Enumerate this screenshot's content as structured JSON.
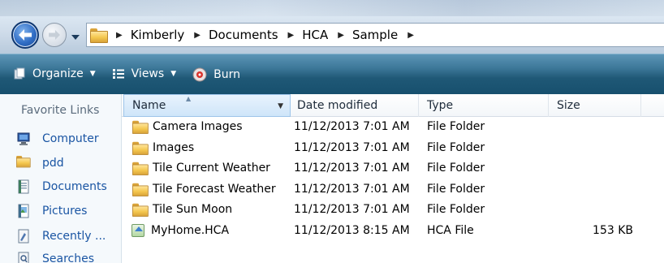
{
  "addressbar": {
    "breadcrumbs": [
      "Kimberly",
      "Documents",
      "HCA",
      "Sample"
    ],
    "back_icon": "back-arrow-icon",
    "forward_icon": "forward-arrow-icon"
  },
  "toolbar": {
    "organize_label": "Organize",
    "views_label": "Views",
    "burn_label": "Burn"
  },
  "favorites": {
    "title": "Favorite Links",
    "items": [
      {
        "label": "Computer",
        "icon": "computer-icon"
      },
      {
        "label": "pdd",
        "icon": "folder-icon"
      },
      {
        "label": "Documents",
        "icon": "documents-icon"
      },
      {
        "label": "Pictures",
        "icon": "pictures-icon"
      },
      {
        "label": "Recently ...",
        "icon": "recent-icon"
      },
      {
        "label": "Searches",
        "icon": "searches-icon"
      }
    ]
  },
  "table": {
    "columns": [
      "Name",
      "Date modified",
      "Type",
      "Size"
    ],
    "rows": [
      {
        "name": "Camera Images",
        "date": "11/12/2013 7:01 AM",
        "type": "File Folder",
        "size": ""
      },
      {
        "name": "Images",
        "date": "11/12/2013 7:01 AM",
        "type": "File Folder",
        "size": ""
      },
      {
        "name": "Tile Current Weather",
        "date": "11/12/2013 7:01 AM",
        "type": "File Folder",
        "size": ""
      },
      {
        "name": "Tile Forecast Weather",
        "date": "11/12/2013 7:01 AM",
        "type": "File Folder",
        "size": ""
      },
      {
        "name": "Tile Sun Moon",
        "date": "11/12/2013 7:01 AM",
        "type": "File Folder",
        "size": ""
      },
      {
        "name": "MyHome.HCA",
        "date": "11/12/2013 8:15 AM",
        "type": "HCA File",
        "size": "153 KB"
      }
    ]
  },
  "colors": {
    "toolbar": "#1f5876",
    "link": "#1a55a3",
    "header_active": "#cfe5f9"
  }
}
